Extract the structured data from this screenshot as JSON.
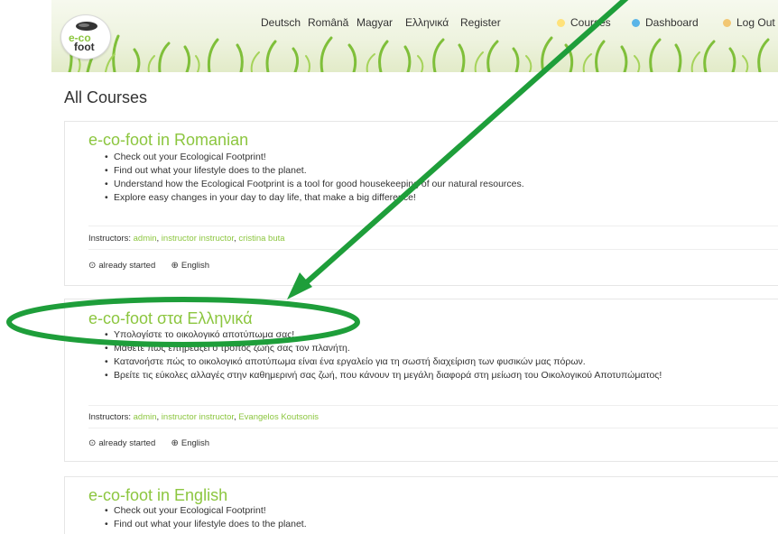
{
  "header": {
    "logo_top": "e-co",
    "logo_bottom": "foot",
    "nav": {
      "deutsch": "Deutsch",
      "romana": "Română",
      "magyar": "Magyar",
      "greek": "Ελληνικά",
      "register": "Register",
      "courses": "Courses",
      "dashboard": "Dashboard",
      "logout": "Log Out"
    }
  },
  "page": {
    "title": "All Courses"
  },
  "courses": [
    {
      "title": "e-co-foot in Romanian",
      "bullets": [
        "Check out your Ecological Footprint!",
        "Find out what your lifestyle does to the planet.",
        "Understand how the Ecological Footprint is a tool for good housekeeping of our natural resources.",
        "Explore easy changes in your day to day life, that make a big difference!"
      ],
      "instructors_label": "Instructors:",
      "instructors": [
        "admin",
        "instructor instructor",
        "cristina buta"
      ],
      "status": "already started",
      "language": "English"
    },
    {
      "title": "e-co-foot στα Ελληνικά",
      "bullets": [
        "Υπολογίστε το οικολογικό αποτύπωμα σας!",
        "Μάθετε πώς επηρεάζει ο τρόπος ζωής σας τον πλανήτη.",
        "Κατανοήστε πώς το οικολογικό αποτύπωμα είναι ένα εργαλείο για τη σωστή διαχείριση των φυσικών μας πόρων.",
        "Βρείτε τις εύκολες αλλαγές στην καθημερινή σας ζωή, που κάνουν τη μεγάλη διαφορά στη μείωση του Οικολογικού Αποτυπώματος!"
      ],
      "instructors_label": "Instructors:",
      "instructors": [
        "admin",
        "instructor instructor",
        "Evangelos Koutsonis"
      ],
      "status": "already started",
      "language": "English"
    },
    {
      "title": "e-co-foot in English",
      "bullets": [
        "Check out your Ecological Footprint!",
        "Find out what your lifestyle does to the planet."
      ]
    }
  ],
  "colors": {
    "brand_green": "#8cc63f",
    "annotation_green": "#1e9e3a"
  }
}
